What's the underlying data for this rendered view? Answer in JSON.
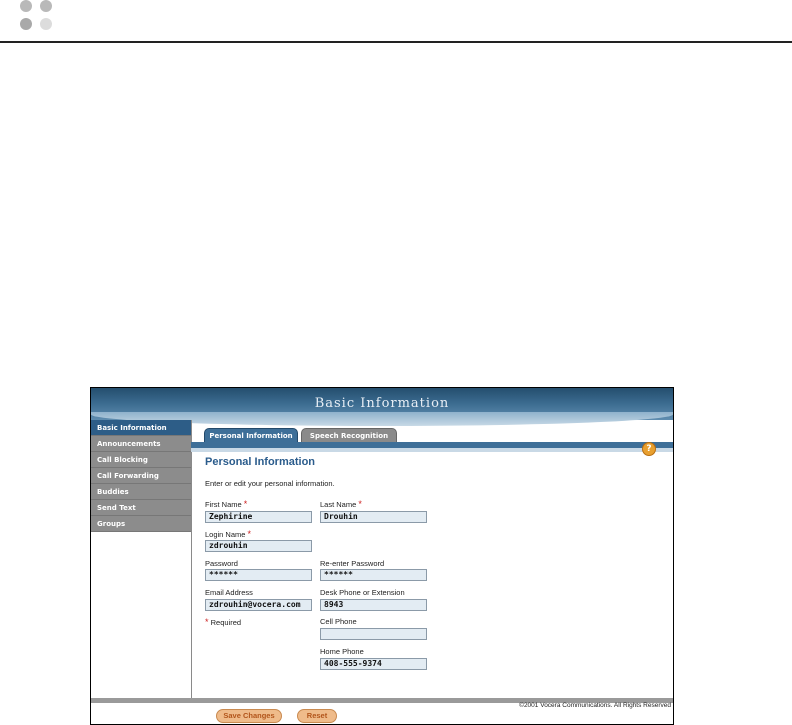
{
  "colors": {
    "banner": "#2d5d87",
    "tab_active": "#3e6f98",
    "tab_inactive": "#8a8a8a",
    "required_star": "#cc1f1f",
    "button_bg": "#efbb8a",
    "dot_dark": "#b9b9b9",
    "dot_light": "#dcdcdc"
  },
  "banner": {
    "title": "Basic Information"
  },
  "sidebar": {
    "items": [
      {
        "label": "Basic Information"
      },
      {
        "label": "Announcements"
      },
      {
        "label": "Call Blocking"
      },
      {
        "label": "Call Forwarding"
      },
      {
        "label": "Buddies"
      },
      {
        "label": "Send Text"
      },
      {
        "label": "Groups"
      }
    ]
  },
  "tabs": [
    {
      "label": "Personal Information"
    },
    {
      "label": "Speech Recognition"
    }
  ],
  "help_icon": "help-icon",
  "section": {
    "title": "Personal Information",
    "intro": "Enter or edit your personal information."
  },
  "form": {
    "first_name": {
      "label": "First Name",
      "value": "Zephirine"
    },
    "last_name": {
      "label": "Last Name",
      "value": "Drouhin"
    },
    "login_name": {
      "label": "Login Name",
      "value": "zdrouhin"
    },
    "password": {
      "label": "Password",
      "value": "******"
    },
    "reenter_password": {
      "label": "Re-enter Password",
      "value": "******"
    },
    "email": {
      "label": "Email Address",
      "value": "zdrouhin@vocera.com"
    },
    "desk_phone": {
      "label": "Desk Phone or Extension",
      "value": "8943"
    },
    "cell_phone": {
      "label": "Cell Phone",
      "value": ""
    },
    "home_phone": {
      "label": "Home Phone",
      "value": "408-555-9374"
    },
    "required_star": "*",
    "required_note": "Required"
  },
  "footer": {
    "copyright": "©2001 Vocera Communications. All Rights Reserved",
    "save_label": "Save Changes",
    "reset_label": "Reset"
  }
}
